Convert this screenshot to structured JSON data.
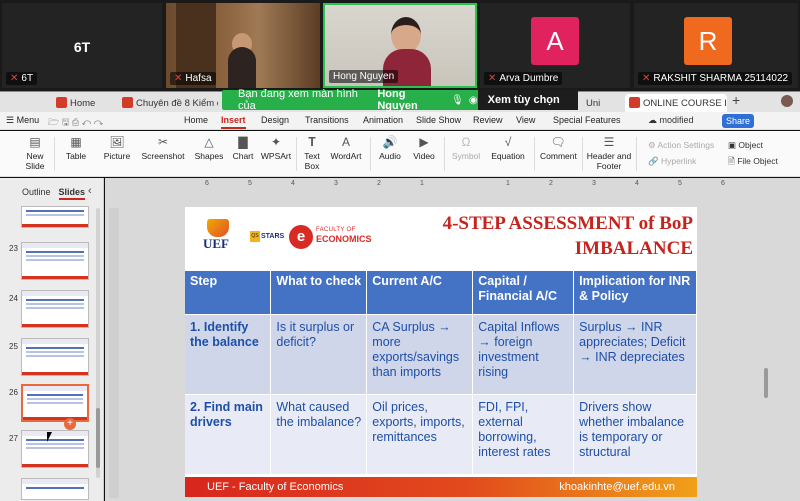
{
  "participants": [
    {
      "label": "6T",
      "big_label": "6T",
      "muted": true
    },
    {
      "label": "Hafsa",
      "muted": true
    },
    {
      "label": "Hong Nguyen",
      "muted": false
    },
    {
      "label": "Arva Dumbre",
      "muted": true,
      "avatar_letter": "A",
      "avatar_color": "#e0225e"
    },
    {
      "label": "RAKSHIT SHARMA 25114022",
      "muted": true,
      "avatar_letter": "R",
      "avatar_color": "#ef6a1f"
    }
  ],
  "share_banner": {
    "message": "Bạn đang xem màn hình của",
    "presenter": "Hong Nguyen",
    "view_options": "Xem tùy chọn"
  },
  "browser_tabs": [
    {
      "label": "Home",
      "icon_color": "#d23b2a"
    },
    {
      "label": "Chuyên đề 8 Kiểm c",
      "icon_color": "#d23b2a"
    },
    {
      "label": "Uni",
      "icon_color": "#d23b2a"
    },
    {
      "label": "ONLINE COURSE IN",
      "icon_color": "#d23b2a"
    }
  ],
  "menubar": {
    "menu": "Menu",
    "items": [
      "Home",
      "Insert",
      "Design",
      "Transitions",
      "Animation",
      "Slide Show",
      "Review",
      "View",
      "Special Features"
    ],
    "active": "Insert",
    "status": "modified",
    "share": "Share"
  },
  "ribbon": {
    "new_slide": "New Slide",
    "table": "Table",
    "picture": "Picture",
    "screenshot": "Screenshot",
    "shapes": "Shapes",
    "chart": "Chart",
    "wpsart": "WPSArt",
    "text_box": "Text Box",
    "wordart": "WordArt",
    "audio": "Audio",
    "video": "Video",
    "symbol": "Symbol",
    "equation": "Equation",
    "comment": "Comment",
    "header_footer": "Header and Footer",
    "action_settings": "Action Settings",
    "hyperlink": "Hyperlink",
    "object": "Object",
    "file_object": "File Object"
  },
  "left_pane": {
    "outline_tab": "Outline",
    "slides_tab": "Slides",
    "slide_numbers": [
      "23",
      "24",
      "25",
      "26",
      "27"
    ]
  },
  "ruler_marks": [
    "6",
    "5",
    "4",
    "3",
    "2",
    "1",
    "1",
    "2",
    "3",
    "4",
    "5",
    "6"
  ],
  "slide": {
    "title": "4-STEP ASSESSMENT of BoP IMBALANCE",
    "logo_uef": "UEF",
    "logo_stars_badge": "QS",
    "logo_stars": "STARS",
    "logo_foe_top": "FACULTY OF",
    "logo_foe_main": "ECONOMICS",
    "headers": [
      "Step",
      "What to check",
      "Current A/C",
      "Capital / Financial A/C",
      "Implication for INR & Policy"
    ],
    "rows": [
      [
        "1. Identify the balance",
        "Is it surplus or deficit?",
        "CA Surplus → more exports/savings than imports",
        "Capital Inflows → foreign investment rising",
        "Surplus → INR appreciates; Deficit → INR depreciates"
      ],
      [
        "2. Find main drivers",
        "What caused the imbalance?",
        "Oil prices, exports, imports, remittances",
        "FDI, FPI, external borrowing, interest rates",
        "Drivers show whether imbalance is temporary or structural"
      ]
    ],
    "footer_left": "UEF - Faculty of Economics",
    "footer_right": "khoakinhte@uef.edu.vn"
  }
}
